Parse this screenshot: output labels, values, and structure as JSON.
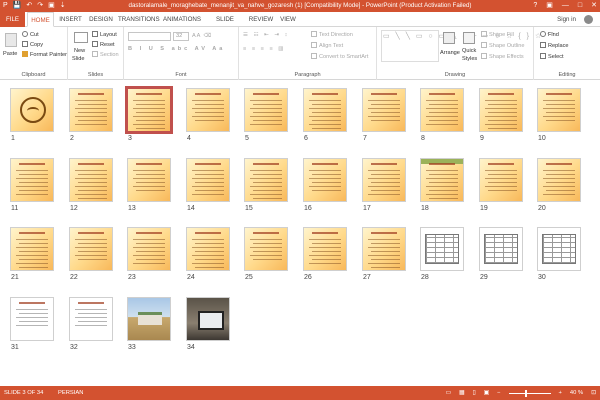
{
  "window": {
    "title": "dastoralamale_moraghebate_menanjit_va_nahve_gozaresh (1) [Compatibility Mode] - PowerPoint (Product Activation Failed)",
    "controls": {
      "help": "?",
      "ribbon_options": "▣",
      "minimize": "—",
      "maximize": "□",
      "close": "✕"
    }
  },
  "qat": {
    "save": "💾",
    "undo": "↶",
    "redo": "↷",
    "start": "▣",
    "customize": "⇣"
  },
  "tabs": {
    "file": "FILE",
    "home": "HOME",
    "insert": "INSERT",
    "design": "DESIGN",
    "transitions": "TRANSITIONS",
    "animations": "ANIMATIONS",
    "slideshow": "SLIDE SHOW",
    "review": "REVIEW",
    "view": "VIEW",
    "active": "HOME",
    "signin": "Sign in"
  },
  "ribbon": {
    "clipboard": {
      "label": "Clipboard",
      "paste": "Paste",
      "cut": "Cut",
      "copy": "Copy",
      "format_painter": "Format Painter"
    },
    "slides": {
      "label": "Slides",
      "new_slide": "New",
      "new_slide_2": "Slide",
      "layout": "Layout",
      "reset": "Reset",
      "section": "Section"
    },
    "font": {
      "label": "Font",
      "size": "32"
    },
    "paragraph": {
      "label": "Paragraph",
      "text_direction": "Text Direction",
      "align_text": "Align Text",
      "convert_smartart": "Convert to SmartArt"
    },
    "drawing": {
      "label": "Drawing",
      "arrange": "Arrange",
      "quick_styles": "Quick",
      "quick_styles_2": "Styles",
      "shape_fill": "Shape Fill",
      "shape_outline": "Shape Outline",
      "shape_effects": "Shape Effects"
    },
    "editing": {
      "label": "Editing",
      "find": "Find",
      "replace": "Replace",
      "select": "Select"
    }
  },
  "slides": {
    "selected": 3,
    "items": [
      {
        "n": "1",
        "style": "seal"
      },
      {
        "n": "2",
        "style": "text"
      },
      {
        "n": "3",
        "style": "text"
      },
      {
        "n": "4",
        "style": "text"
      },
      {
        "n": "5",
        "style": "text"
      },
      {
        "n": "6",
        "style": "text"
      },
      {
        "n": "7",
        "style": "text"
      },
      {
        "n": "8",
        "style": "text"
      },
      {
        "n": "9",
        "style": "text"
      },
      {
        "n": "10",
        "style": "text"
      },
      {
        "n": "11",
        "style": "text"
      },
      {
        "n": "12",
        "style": "text"
      },
      {
        "n": "13",
        "style": "text"
      },
      {
        "n": "14",
        "style": "text"
      },
      {
        "n": "15",
        "style": "text"
      },
      {
        "n": "16",
        "style": "text"
      },
      {
        "n": "17",
        "style": "text"
      },
      {
        "n": "18",
        "style": "green"
      },
      {
        "n": "19",
        "style": "text"
      },
      {
        "n": "20",
        "style": "text"
      },
      {
        "n": "21",
        "style": "text"
      },
      {
        "n": "22",
        "style": "text"
      },
      {
        "n": "23",
        "style": "text"
      },
      {
        "n": "24",
        "style": "text"
      },
      {
        "n": "25",
        "style": "text"
      },
      {
        "n": "26",
        "style": "text"
      },
      {
        "n": "27",
        "style": "text"
      },
      {
        "n": "28",
        "style": "table"
      },
      {
        "n": "29",
        "style": "table"
      },
      {
        "n": "30",
        "style": "table"
      },
      {
        "n": "31",
        "style": "form"
      },
      {
        "n": "32",
        "style": "form"
      },
      {
        "n": "33",
        "style": "photo1"
      },
      {
        "n": "34",
        "style": "photo2"
      }
    ]
  },
  "status": {
    "slide": "SLIDE 3 OF 34",
    "language": "PERSIAN",
    "zoom": "40 %",
    "zoom_level": 0.4
  },
  "colors": {
    "accent": "#d35230",
    "thumb_light": "#fff4cc",
    "thumb_dark": "#f8b85a",
    "selection": "#c0504d"
  }
}
